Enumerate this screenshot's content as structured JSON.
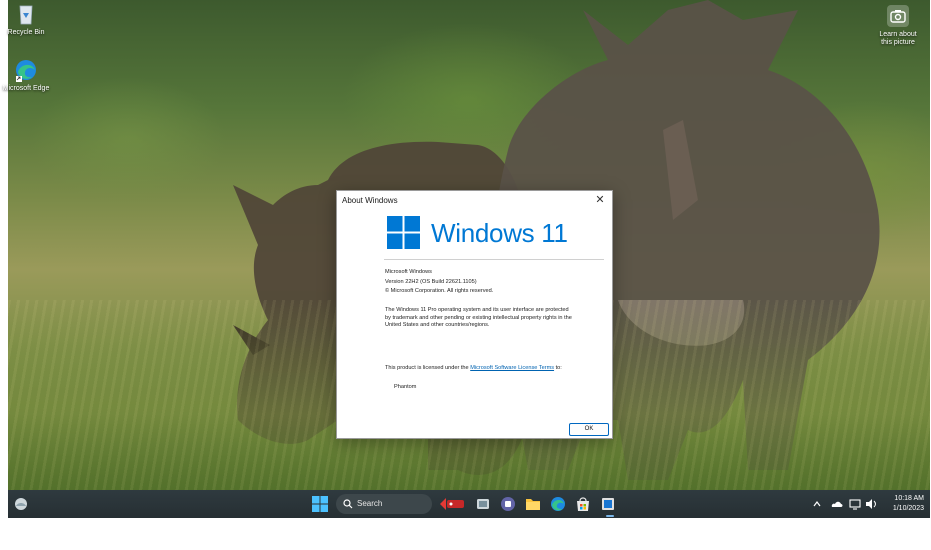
{
  "desktop": {
    "icons": [
      {
        "name": "recycle-bin",
        "label": "Recycle Bin"
      },
      {
        "name": "microsoft-edge",
        "label": "Microsoft Edge"
      }
    ],
    "learn_label": "Learn about this picture"
  },
  "dialog": {
    "title": "About Windows",
    "close_glyph": "✕",
    "logo_text": "Windows 11",
    "product": "Microsoft Windows",
    "version": "Version 22H2 (OS Build 22621.1105)",
    "copyright": "© Microsoft Corporation. All rights reserved.",
    "legal": "The Windows 11 Pro operating system and its user interface are protected by trademark and other pending or existing intellectual property rights in the United States and other countries/regions.",
    "license_prefix": "This product is licensed under the ",
    "license_link": "Microsoft Software License Terms",
    "license_suffix": " to:",
    "licensee": "Phantom",
    "ok_label": "OK",
    "logo_color": "#0078d4"
  },
  "taskbar": {
    "search_label": "Search",
    "apps": [
      "widgets-icon",
      "start-icon",
      "search-icon",
      "app-icon",
      "file-icon",
      "teams-icon",
      "folder-icon",
      "edge-icon",
      "store-icon",
      "settings-icon"
    ],
    "time": "10:18 AM",
    "date": "1/10/2023"
  }
}
